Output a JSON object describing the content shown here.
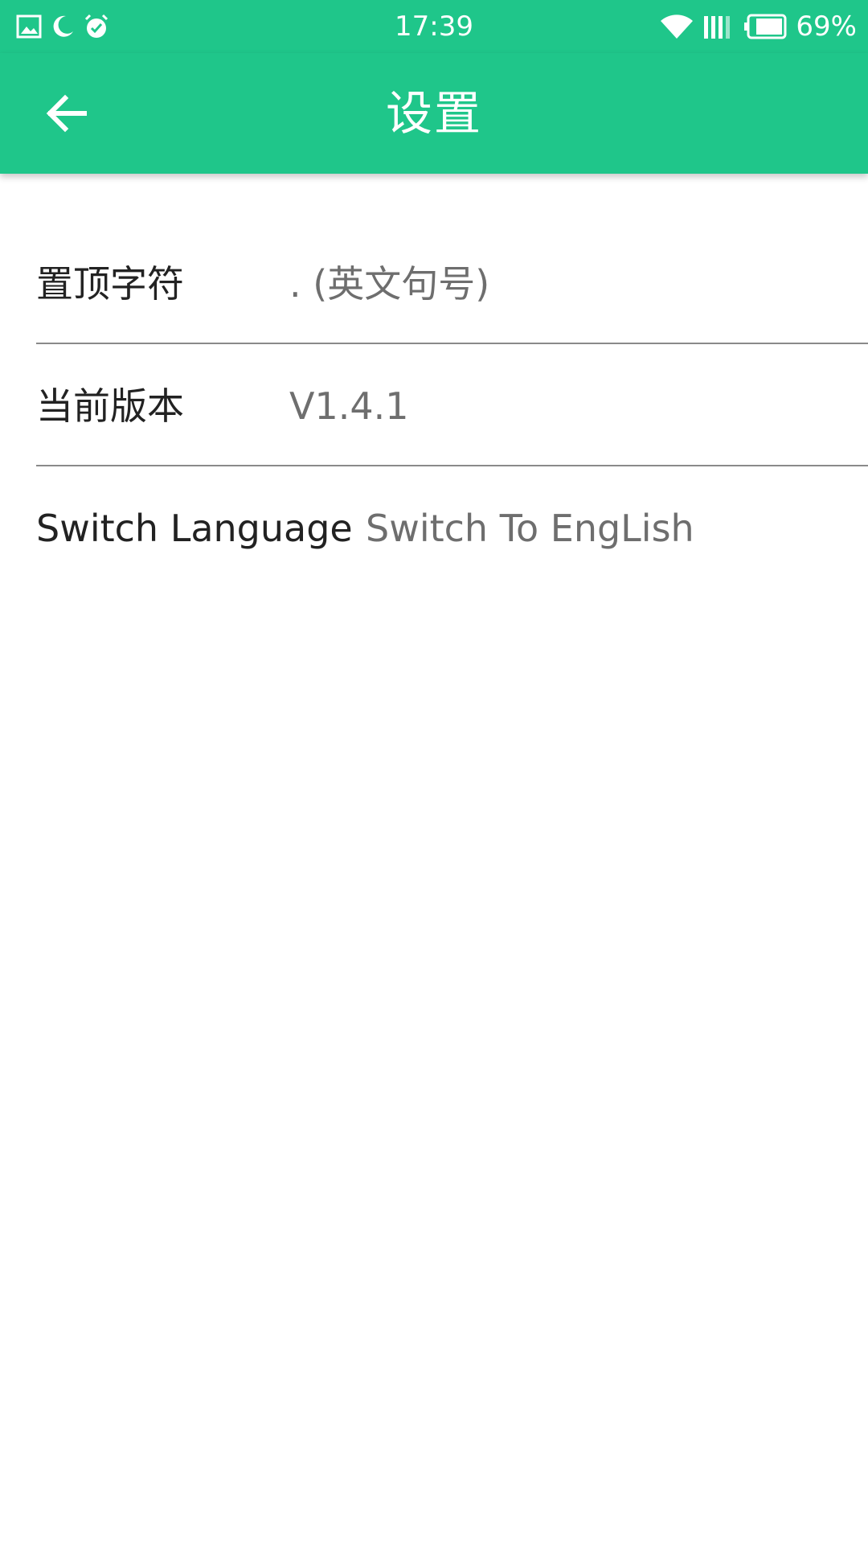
{
  "status_bar": {
    "time": "17:39",
    "battery_percent": "69%",
    "left_icons": [
      "image-notification-icon",
      "night-mode-icon",
      "alarm-icon"
    ],
    "right_icons": [
      "wifi-icon",
      "signal-icon",
      "battery-icon"
    ]
  },
  "app_bar": {
    "title": "设置",
    "back_icon": "arrow-left-icon",
    "color": "#1fc68a"
  },
  "settings": [
    {
      "label": "置顶字符",
      "value": ". (英文句号)"
    },
    {
      "label": "当前版本",
      "value": "V1.4.1"
    },
    {
      "label": "Switch Language",
      "value": "Switch To EngLish"
    }
  ]
}
